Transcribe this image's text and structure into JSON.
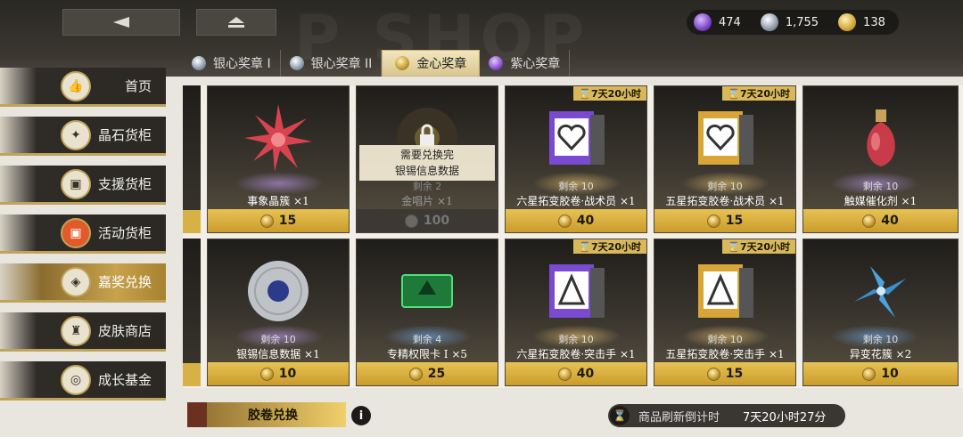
{
  "header": {
    "watermark": "P SHOP",
    "back_icon": "back-arrow-icon",
    "home_icon": "home-icon",
    "currencies": [
      {
        "icon": "purple-crystal-icon",
        "value": "474",
        "color": "#8b55d6"
      },
      {
        "icon": "silver-medal-icon",
        "value": "1,755",
        "color": "#9aa7b3"
      },
      {
        "icon": "gold-medal-icon",
        "value": "138",
        "color": "#d4a52f"
      }
    ]
  },
  "tabs": [
    {
      "label": "银心奖章 I",
      "icon": "silver-medal-icon",
      "active": false
    },
    {
      "label": "银心奖章 II",
      "icon": "silver-medal-icon",
      "active": false
    },
    {
      "label": "金心奖章",
      "icon": "gold-medal-icon",
      "active": true
    },
    {
      "label": "紫心奖章",
      "icon": "purple-medal-icon",
      "active": false
    }
  ],
  "sidebar": {
    "items": [
      {
        "label": "首页",
        "icon": "thumbs-up-icon",
        "active": false
      },
      {
        "label": "晶石货柜",
        "icon": "crystal-icon",
        "active": false
      },
      {
        "label": "支援货柜",
        "icon": "crate-icon",
        "active": false
      },
      {
        "label": "活动货柜",
        "icon": "crate-icon",
        "active": false
      },
      {
        "label": "嘉奖兑换",
        "icon": "medal-icon",
        "active": true
      },
      {
        "label": "皮肤商店",
        "icon": "outfit-icon",
        "active": false
      },
      {
        "label": "成长基金",
        "icon": "fund-icon",
        "active": false
      }
    ]
  },
  "items": [
    {
      "name": "事象晶簇 ×1",
      "remain": "",
      "price": "15",
      "timer": "",
      "locked": false,
      "art": "red-crystal-icon"
    },
    {
      "name": "金唱片 ×1",
      "remain": "剩余 2",
      "price": "100",
      "timer": "",
      "locked": true,
      "lock_line1": "需要兑换完",
      "lock_line2": "银锡信息数据",
      "art": "gold-record-icon"
    },
    {
      "name": "六星拓变胶卷·战术员 ×1",
      "remain": "剩余 10",
      "price": "40",
      "timer": "7天20小时",
      "locked": false,
      "art": "film-heart-icon"
    },
    {
      "name": "五星拓变胶卷·战术员 ×1",
      "remain": "剩余 10",
      "price": "15",
      "timer": "7天20小时",
      "locked": false,
      "art": "film-heart-gold-icon"
    },
    {
      "name": "触媒催化剂 ×1",
      "remain": "剩余 10",
      "price": "40",
      "timer": "",
      "locked": false,
      "art": "perfume-bottle-icon"
    },
    {
      "name": "银锡信息数据 ×1",
      "remain": "剩余 10",
      "price": "10",
      "timer": "",
      "locked": false,
      "art": "silver-record-icon"
    },
    {
      "name": "专精权限卡 I ×5",
      "remain": "剩余 4",
      "price": "25",
      "timer": "",
      "locked": false,
      "art": "green-card-icon"
    },
    {
      "name": "六星拓变胶卷·突击手 ×1",
      "remain": "剩余 10",
      "price": "40",
      "timer": "7天20小时",
      "locked": false,
      "art": "film-arrow-icon"
    },
    {
      "name": "五星拓变胶卷·突击手 ×1",
      "remain": "剩余 10",
      "price": "15",
      "timer": "7天20小时",
      "locked": false,
      "art": "film-arrow-gold-icon"
    },
    {
      "name": "异变花簇 ×2",
      "remain": "剩余 10",
      "price": "10",
      "timer": "",
      "locked": false,
      "art": "blue-flower-icon"
    }
  ],
  "footer": {
    "exchange_label": "胶卷兑换",
    "info_icon": "i",
    "refresh_label": "商品刷新倒计时",
    "refresh_time": "7天20小时27分",
    "hourglass_icon": "hourglass-icon"
  }
}
